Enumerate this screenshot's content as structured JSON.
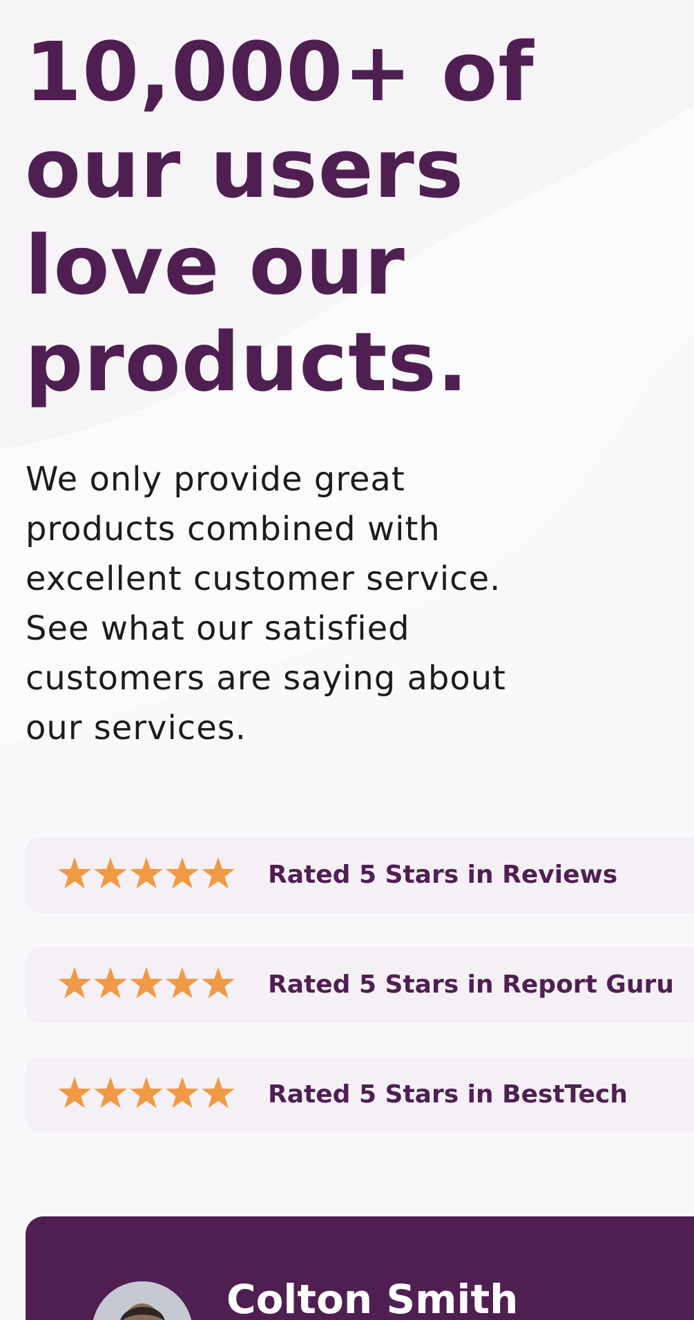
{
  "headline": {
    "lines": [
      "10,000+ of",
      "our users",
      "love our",
      "products."
    ]
  },
  "description": {
    "lines": [
      "We only provide great",
      "products combined with",
      "excellent customer service.",
      "See what our satisfied",
      "customers are saying about",
      "our services."
    ]
  },
  "ratings": [
    {
      "label": "Rated 5 Stars in Reviews",
      "stars": 5
    },
    {
      "label": "Rated 5 Stars in Report Guru",
      "stars": 5
    },
    {
      "label": "Rated 5 Stars in BestTech",
      "stars": 5
    }
  ],
  "testimonial": {
    "author": "Colton Smith"
  },
  "colors": {
    "brand_purple": "#4f1f52",
    "star_orange": "#f09a45",
    "card_bg": "#f5f0f5",
    "page_bg": "#fbfafc"
  },
  "icons": {
    "star": "star-icon",
    "avatar": "avatar-photo"
  }
}
